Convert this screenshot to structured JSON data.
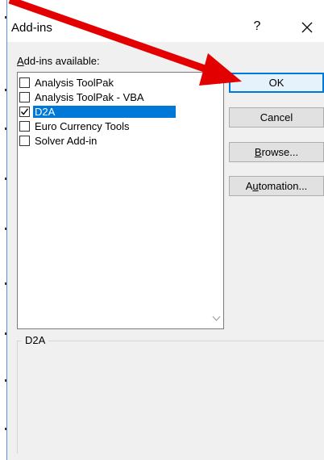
{
  "window": {
    "title": "Add-ins",
    "help_label": "?",
    "close_icon": "close-icon"
  },
  "addins": {
    "label_prefix": "A",
    "label_rest": "dd-ins available:",
    "items": [
      {
        "label": "Analysis ToolPak",
        "checked": false,
        "selected": false
      },
      {
        "label": "Analysis ToolPak - VBA",
        "checked": false,
        "selected": false
      },
      {
        "label": "D2A",
        "checked": true,
        "selected": true
      },
      {
        "label": "Euro Currency Tools",
        "checked": false,
        "selected": false
      },
      {
        "label": "Solver Add-in",
        "checked": false,
        "selected": false
      }
    ]
  },
  "buttons": {
    "ok": "OK",
    "cancel": "Cancel",
    "browse_prefix": "B",
    "browse_rest": "rowse...",
    "automation_prefix": "A",
    "automation_u": "u",
    "automation_rest": "tomation..."
  },
  "description": {
    "group_title": "D2A"
  },
  "colors": {
    "accent": "#0078d7",
    "annotation_arrow": "#e30000"
  }
}
